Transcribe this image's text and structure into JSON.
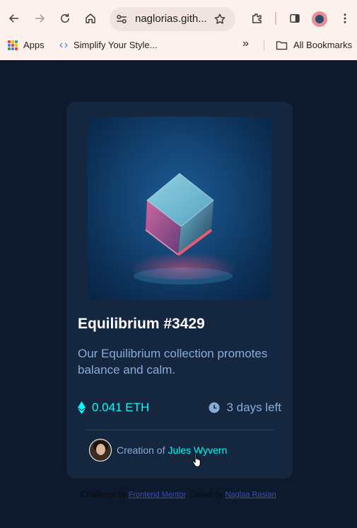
{
  "browser": {
    "url": "naglorias.gith...",
    "bookmarks": {
      "apps_label": "Apps",
      "simplify_label": "Simplify Your Style...",
      "all_bookmarks_label": "All Bookmarks",
      "overflow_symbol": "»"
    },
    "icons": [
      "back-icon",
      "forward-icon",
      "reload-icon",
      "home-icon",
      "site-settings-icon",
      "star-icon",
      "extensions-icon",
      "side-panel-icon",
      "profile-avatar",
      "menu-icon"
    ]
  },
  "card": {
    "title": "Equilibrium #3429",
    "description": "Our Equilibrium collection promotes balance and calm.",
    "price": "0.041 ETH",
    "time_left": "3 days left",
    "creator_prefix": "Creation of",
    "creator_name": "Jules Wyvern"
  },
  "attribution": {
    "challenge_prefix": "Challenge by",
    "challenge_link": "Frontend Mentor",
    "coded_prefix": ". Coded by",
    "coder_link": "Naglaa Raslan"
  },
  "colors": {
    "page_bg": "#0d1a2d",
    "card_bg": "#15263f",
    "cyan": "#00fff8",
    "soft_blue": "#8bacd9",
    "white": "#ffffff",
    "link": "#3d4eab"
  }
}
